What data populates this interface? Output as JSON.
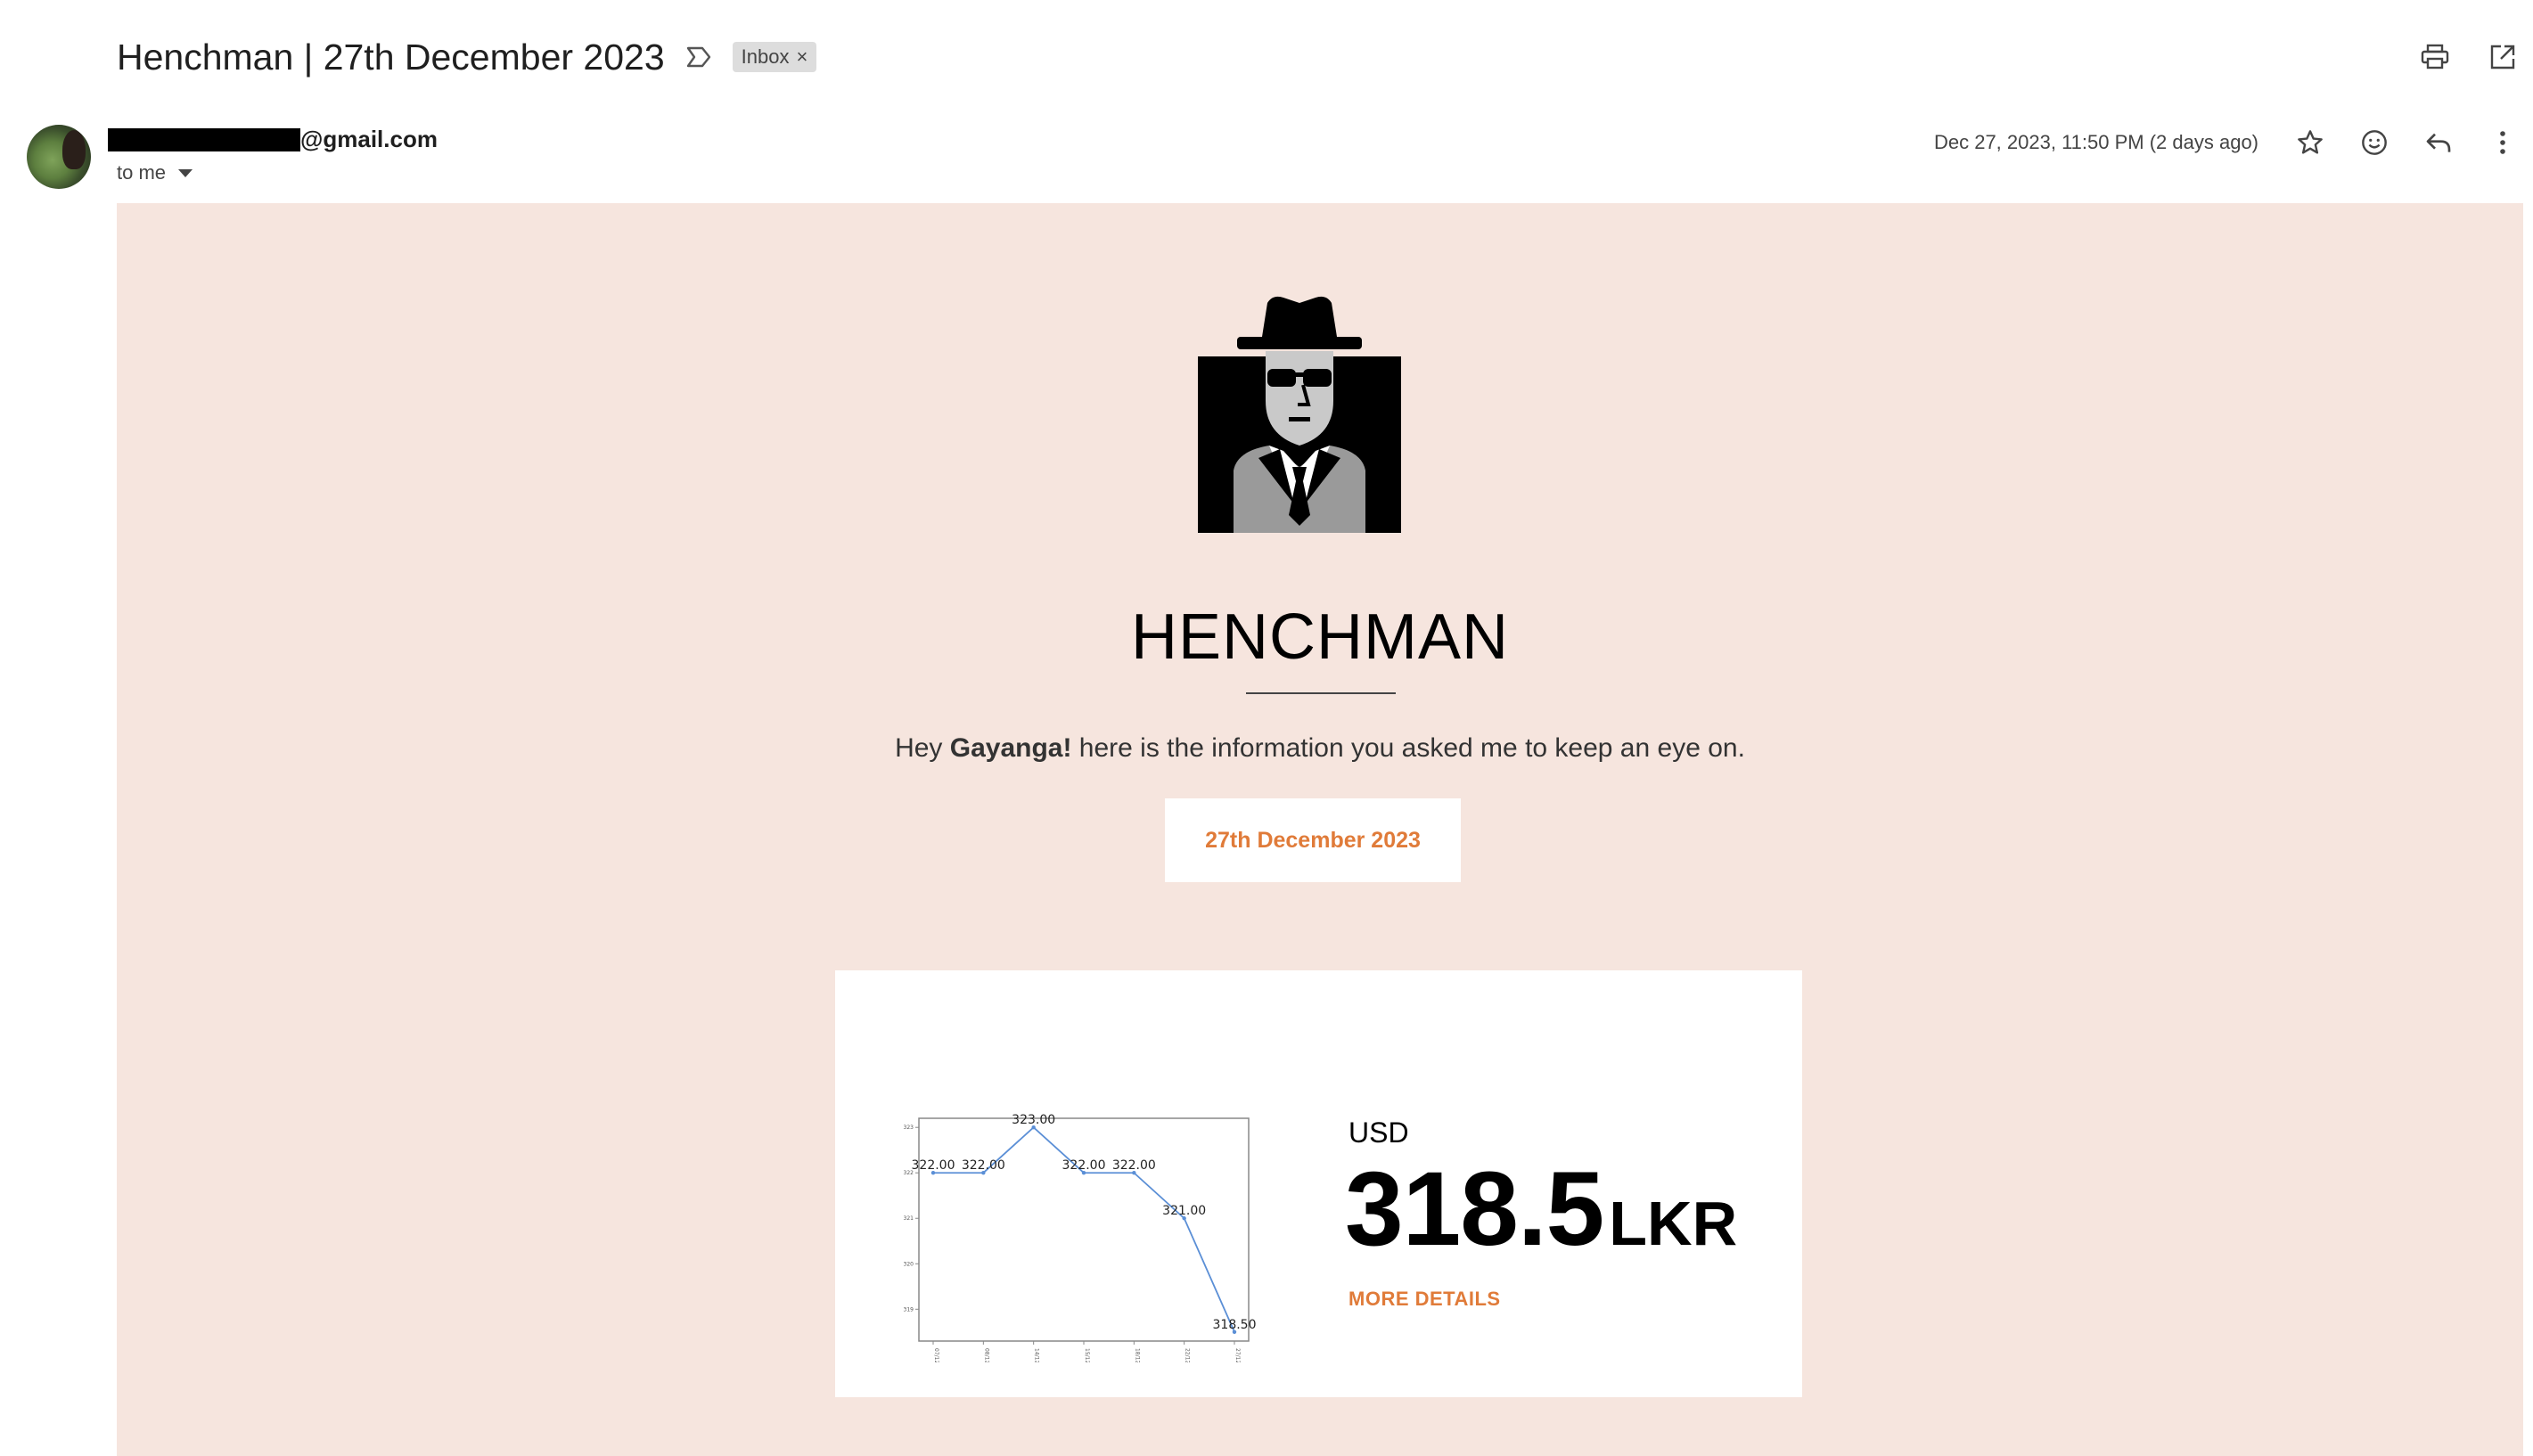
{
  "email": {
    "subject": "Henchman | 27th December 2023",
    "label": "Inbox",
    "label_remove": "×",
    "sender_domain": "@gmail.com",
    "recipient": "to me",
    "date": "Dec 27, 2023, 11:50 PM (2 days ago)"
  },
  "body": {
    "brand": "HENCHMAN",
    "greeting_prefix": "Hey ",
    "greeting_name": "Gayanga!",
    "greeting_suffix": " here is the information you asked me to keep an eye on.",
    "date_button": "27th December 2023",
    "card": {
      "currency": "USD",
      "rate": "318.5",
      "rate_unit": "LKR",
      "more_details": "MORE DETAILS"
    }
  },
  "chart_data": {
    "type": "line",
    "x": [
      "07/12",
      "08/12",
      "14/12",
      "15/12",
      "18/12",
      "22/12",
      "27/12"
    ],
    "values": [
      322.0,
      322.0,
      323.0,
      322.0,
      322.0,
      321.0,
      318.5
    ],
    "data_labels": [
      "322.00",
      "322.00",
      "323.00",
      "322.00",
      "322.00",
      "321.00",
      "318.50"
    ],
    "y_ticks": [
      "323",
      "322",
      "321",
      "320",
      "319"
    ],
    "ylim": [
      318.3,
      323.2
    ],
    "line_color": "#5b8fd6",
    "grid": false
  },
  "colors": {
    "body_bg": "#f6e5de",
    "accent": "#e07b39"
  }
}
